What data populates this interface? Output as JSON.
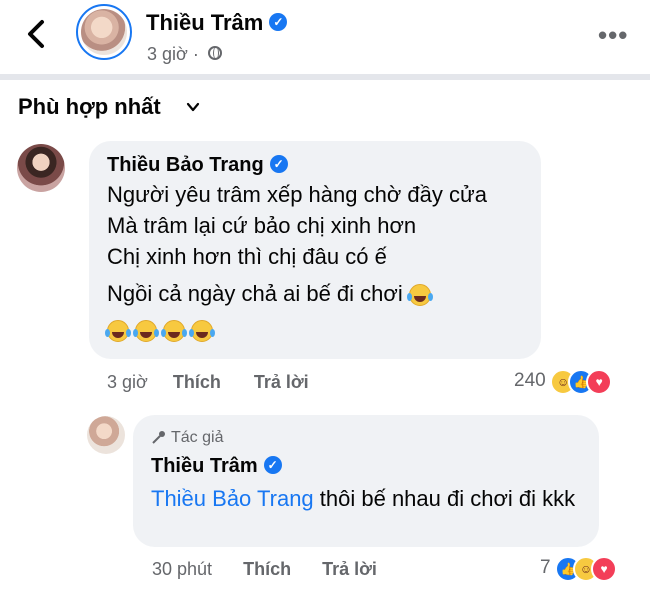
{
  "header": {
    "author_name": "Thiều Trâm",
    "time": "3 giờ"
  },
  "sort": {
    "label": "Phù hợp nhất"
  },
  "comments": [
    {
      "name": "Thiều Bảo Trang",
      "lines": [
        "Người yêu trâm xếp hàng chờ đầy cửa",
        "Mà trâm lại cứ bảo chị xinh hơn",
        "Chị xinh hơn thì chị đâu có ế",
        "Ngồi cả ngày chả ai bế đi chơi"
      ],
      "time": "3 giờ",
      "like_label": "Thích",
      "reply_label": "Trả lời",
      "reaction_count": "240"
    },
    {
      "badge": "Tác giả",
      "name": "Thiều Trâm",
      "mention": "Thiều Bảo Trang",
      "text": " thôi bế nhau đi chơi đi kkk",
      "time": "30 phút",
      "like_label": "Thích",
      "reply_label": "Trả lời",
      "reaction_count": "7"
    }
  ],
  "colors": {
    "accent": "#1877f2",
    "bubble": "#f0f2f5",
    "secondary_text": "#65676b"
  }
}
